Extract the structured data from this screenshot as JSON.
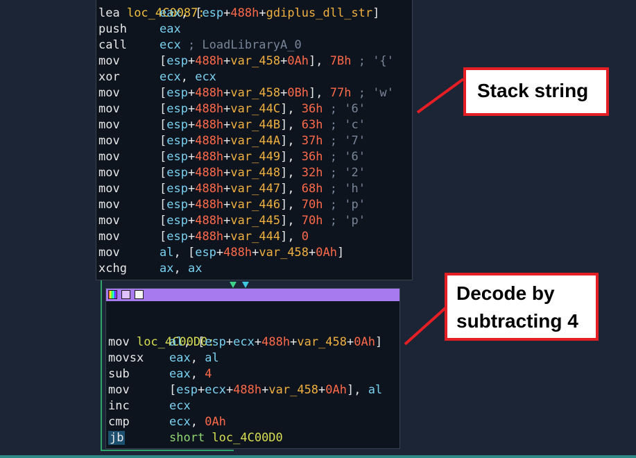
{
  "block1": {
    "label_partial": "loc_4C0087:",
    "lines": [
      {
        "mn": "lea",
        "parts": [
          [
            "reg",
            "eax"
          ],
          [
            "punc",
            ", ["
          ],
          [
            "reg",
            "esp"
          ],
          [
            "punc",
            "+"
          ],
          [
            "num",
            "488h"
          ],
          [
            "punc",
            "+"
          ],
          [
            "var",
            "gdiplus_dll_str"
          ],
          [
            "punc",
            "]"
          ]
        ]
      },
      {
        "mn": "push",
        "parts": [
          [
            "reg",
            "eax"
          ]
        ]
      },
      {
        "mn": "call",
        "parts": [
          [
            "reg",
            "ecx"
          ],
          [
            "cmt",
            " ; LoadLibraryA_0"
          ]
        ]
      },
      {
        "mn": "mov",
        "parts": [
          [
            "punc",
            "["
          ],
          [
            "reg",
            "esp"
          ],
          [
            "punc",
            "+"
          ],
          [
            "num",
            "488h"
          ],
          [
            "punc",
            "+"
          ],
          [
            "var",
            "var_458"
          ],
          [
            "punc",
            "+"
          ],
          [
            "num",
            "0Ah"
          ],
          [
            "punc",
            "], "
          ],
          [
            "num",
            "7Bh"
          ],
          [
            "cmt",
            " ; '{'"
          ]
        ]
      },
      {
        "mn": "xor",
        "parts": [
          [
            "reg",
            "ecx"
          ],
          [
            "punc",
            ", "
          ],
          [
            "reg",
            "ecx"
          ]
        ]
      },
      {
        "mn": "mov",
        "parts": [
          [
            "punc",
            "["
          ],
          [
            "reg",
            "esp"
          ],
          [
            "punc",
            "+"
          ],
          [
            "num",
            "488h"
          ],
          [
            "punc",
            "+"
          ],
          [
            "var",
            "var_458"
          ],
          [
            "punc",
            "+"
          ],
          [
            "num",
            "0Bh"
          ],
          [
            "punc",
            "], "
          ],
          [
            "num",
            "77h"
          ],
          [
            "cmt",
            " ; 'w'"
          ]
        ]
      },
      {
        "mn": "mov",
        "parts": [
          [
            "punc",
            "["
          ],
          [
            "reg",
            "esp"
          ],
          [
            "punc",
            "+"
          ],
          [
            "num",
            "488h"
          ],
          [
            "punc",
            "+"
          ],
          [
            "var",
            "var_44C"
          ],
          [
            "punc",
            "], "
          ],
          [
            "num",
            "36h"
          ],
          [
            "cmt",
            " ; '6'"
          ]
        ]
      },
      {
        "mn": "mov",
        "parts": [
          [
            "punc",
            "["
          ],
          [
            "reg",
            "esp"
          ],
          [
            "punc",
            "+"
          ],
          [
            "num",
            "488h"
          ],
          [
            "punc",
            "+"
          ],
          [
            "var",
            "var_44B"
          ],
          [
            "punc",
            "], "
          ],
          [
            "num",
            "63h"
          ],
          [
            "cmt",
            " ; 'c'"
          ]
        ]
      },
      {
        "mn": "mov",
        "parts": [
          [
            "punc",
            "["
          ],
          [
            "reg",
            "esp"
          ],
          [
            "punc",
            "+"
          ],
          [
            "num",
            "488h"
          ],
          [
            "punc",
            "+"
          ],
          [
            "var",
            "var_44A"
          ],
          [
            "punc",
            "], "
          ],
          [
            "num",
            "37h"
          ],
          [
            "cmt",
            " ; '7'"
          ]
        ]
      },
      {
        "mn": "mov",
        "parts": [
          [
            "punc",
            "["
          ],
          [
            "reg",
            "esp"
          ],
          [
            "punc",
            "+"
          ],
          [
            "num",
            "488h"
          ],
          [
            "punc",
            "+"
          ],
          [
            "var",
            "var_449"
          ],
          [
            "punc",
            "], "
          ],
          [
            "num",
            "36h"
          ],
          [
            "cmt",
            " ; '6'"
          ]
        ]
      },
      {
        "mn": "mov",
        "parts": [
          [
            "punc",
            "["
          ],
          [
            "reg",
            "esp"
          ],
          [
            "punc",
            "+"
          ],
          [
            "num",
            "488h"
          ],
          [
            "punc",
            "+"
          ],
          [
            "var",
            "var_448"
          ],
          [
            "punc",
            "], "
          ],
          [
            "num",
            "32h"
          ],
          [
            "cmt",
            " ; '2'"
          ]
        ]
      },
      {
        "mn": "mov",
        "parts": [
          [
            "punc",
            "["
          ],
          [
            "reg",
            "esp"
          ],
          [
            "punc",
            "+"
          ],
          [
            "num",
            "488h"
          ],
          [
            "punc",
            "+"
          ],
          [
            "var",
            "var_447"
          ],
          [
            "punc",
            "], "
          ],
          [
            "num",
            "68h"
          ],
          [
            "cmt",
            " ; 'h'"
          ]
        ]
      },
      {
        "mn": "mov",
        "parts": [
          [
            "punc",
            "["
          ],
          [
            "reg",
            "esp"
          ],
          [
            "punc",
            "+"
          ],
          [
            "num",
            "488h"
          ],
          [
            "punc",
            "+"
          ],
          [
            "var",
            "var_446"
          ],
          [
            "punc",
            "], "
          ],
          [
            "num",
            "70h"
          ],
          [
            "cmt",
            " ; 'p'"
          ]
        ]
      },
      {
        "mn": "mov",
        "parts": [
          [
            "punc",
            "["
          ],
          [
            "reg",
            "esp"
          ],
          [
            "punc",
            "+"
          ],
          [
            "num",
            "488h"
          ],
          [
            "punc",
            "+"
          ],
          [
            "var",
            "var_445"
          ],
          [
            "punc",
            "], "
          ],
          [
            "num",
            "70h"
          ],
          [
            "cmt",
            " ; 'p'"
          ]
        ]
      },
      {
        "mn": "mov",
        "parts": [
          [
            "punc",
            "["
          ],
          [
            "reg",
            "esp"
          ],
          [
            "punc",
            "+"
          ],
          [
            "num",
            "488h"
          ],
          [
            "punc",
            "+"
          ],
          [
            "var",
            "var_444"
          ],
          [
            "punc",
            "], "
          ],
          [
            "num",
            "0"
          ]
        ]
      },
      {
        "mn": "mov",
        "parts": [
          [
            "reg",
            "al"
          ],
          [
            "punc",
            ", ["
          ],
          [
            "reg",
            "esp"
          ],
          [
            "punc",
            "+"
          ],
          [
            "num",
            "488h"
          ],
          [
            "punc",
            "+"
          ],
          [
            "var",
            "var_458"
          ],
          [
            "punc",
            "+"
          ],
          [
            "num",
            "0Ah"
          ],
          [
            "punc",
            "]"
          ]
        ]
      },
      {
        "mn": "xchg",
        "parts": [
          [
            "reg",
            "ax"
          ],
          [
            "punc",
            ", "
          ],
          [
            "reg",
            "ax"
          ]
        ]
      }
    ]
  },
  "block2": {
    "label": "loc_4C00D0:",
    "lines": [
      {
        "mn": "mov",
        "parts": [
          [
            "reg",
            "al"
          ],
          [
            "punc",
            ", ["
          ],
          [
            "reg",
            "esp"
          ],
          [
            "punc",
            "+"
          ],
          [
            "reg",
            "ecx"
          ],
          [
            "punc",
            "+"
          ],
          [
            "num",
            "488h"
          ],
          [
            "punc",
            "+"
          ],
          [
            "var",
            "var_458"
          ],
          [
            "punc",
            "+"
          ],
          [
            "num",
            "0Ah"
          ],
          [
            "punc",
            "]"
          ]
        ]
      },
      {
        "mn": "movsx",
        "parts": [
          [
            "reg",
            "eax"
          ],
          [
            "punc",
            ", "
          ],
          [
            "reg",
            "al"
          ]
        ]
      },
      {
        "mn": "sub",
        "parts": [
          [
            "reg",
            "eax"
          ],
          [
            "punc",
            ", "
          ],
          [
            "num",
            "4"
          ]
        ]
      },
      {
        "mn": "mov",
        "parts": [
          [
            "punc",
            "["
          ],
          [
            "reg",
            "esp"
          ],
          [
            "punc",
            "+"
          ],
          [
            "reg",
            "ecx"
          ],
          [
            "punc",
            "+"
          ],
          [
            "num",
            "488h"
          ],
          [
            "punc",
            "+"
          ],
          [
            "var",
            "var_458"
          ],
          [
            "punc",
            "+"
          ],
          [
            "num",
            "0Ah"
          ],
          [
            "punc",
            "], "
          ],
          [
            "reg",
            "al"
          ]
        ]
      },
      {
        "mn": "inc",
        "parts": [
          [
            "reg",
            "ecx"
          ]
        ]
      },
      {
        "mn": "cmp",
        "parts": [
          [
            "reg",
            "ecx"
          ],
          [
            "punc",
            ", "
          ],
          [
            "num",
            "0Ah"
          ]
        ]
      },
      {
        "mn": "jb",
        "parts": [
          [
            "kw",
            "short "
          ],
          [
            "loc",
            "loc_4C00D0"
          ]
        ]
      }
    ]
  },
  "callouts": {
    "stack_string": "Stack string",
    "decode_line1": "Decode by",
    "decode_line2": "subtracting 4"
  },
  "colors": {
    "background": "#1c2535",
    "block_bg": "#0e141e",
    "callout_border": "#e31e24",
    "header_purple": "#a77af0",
    "register": "#79d1f0",
    "number": "#ff6a4a",
    "variable": "#f0b040"
  },
  "icons": [
    "color-palette-icon",
    "edit-icon",
    "graph-icon"
  ]
}
